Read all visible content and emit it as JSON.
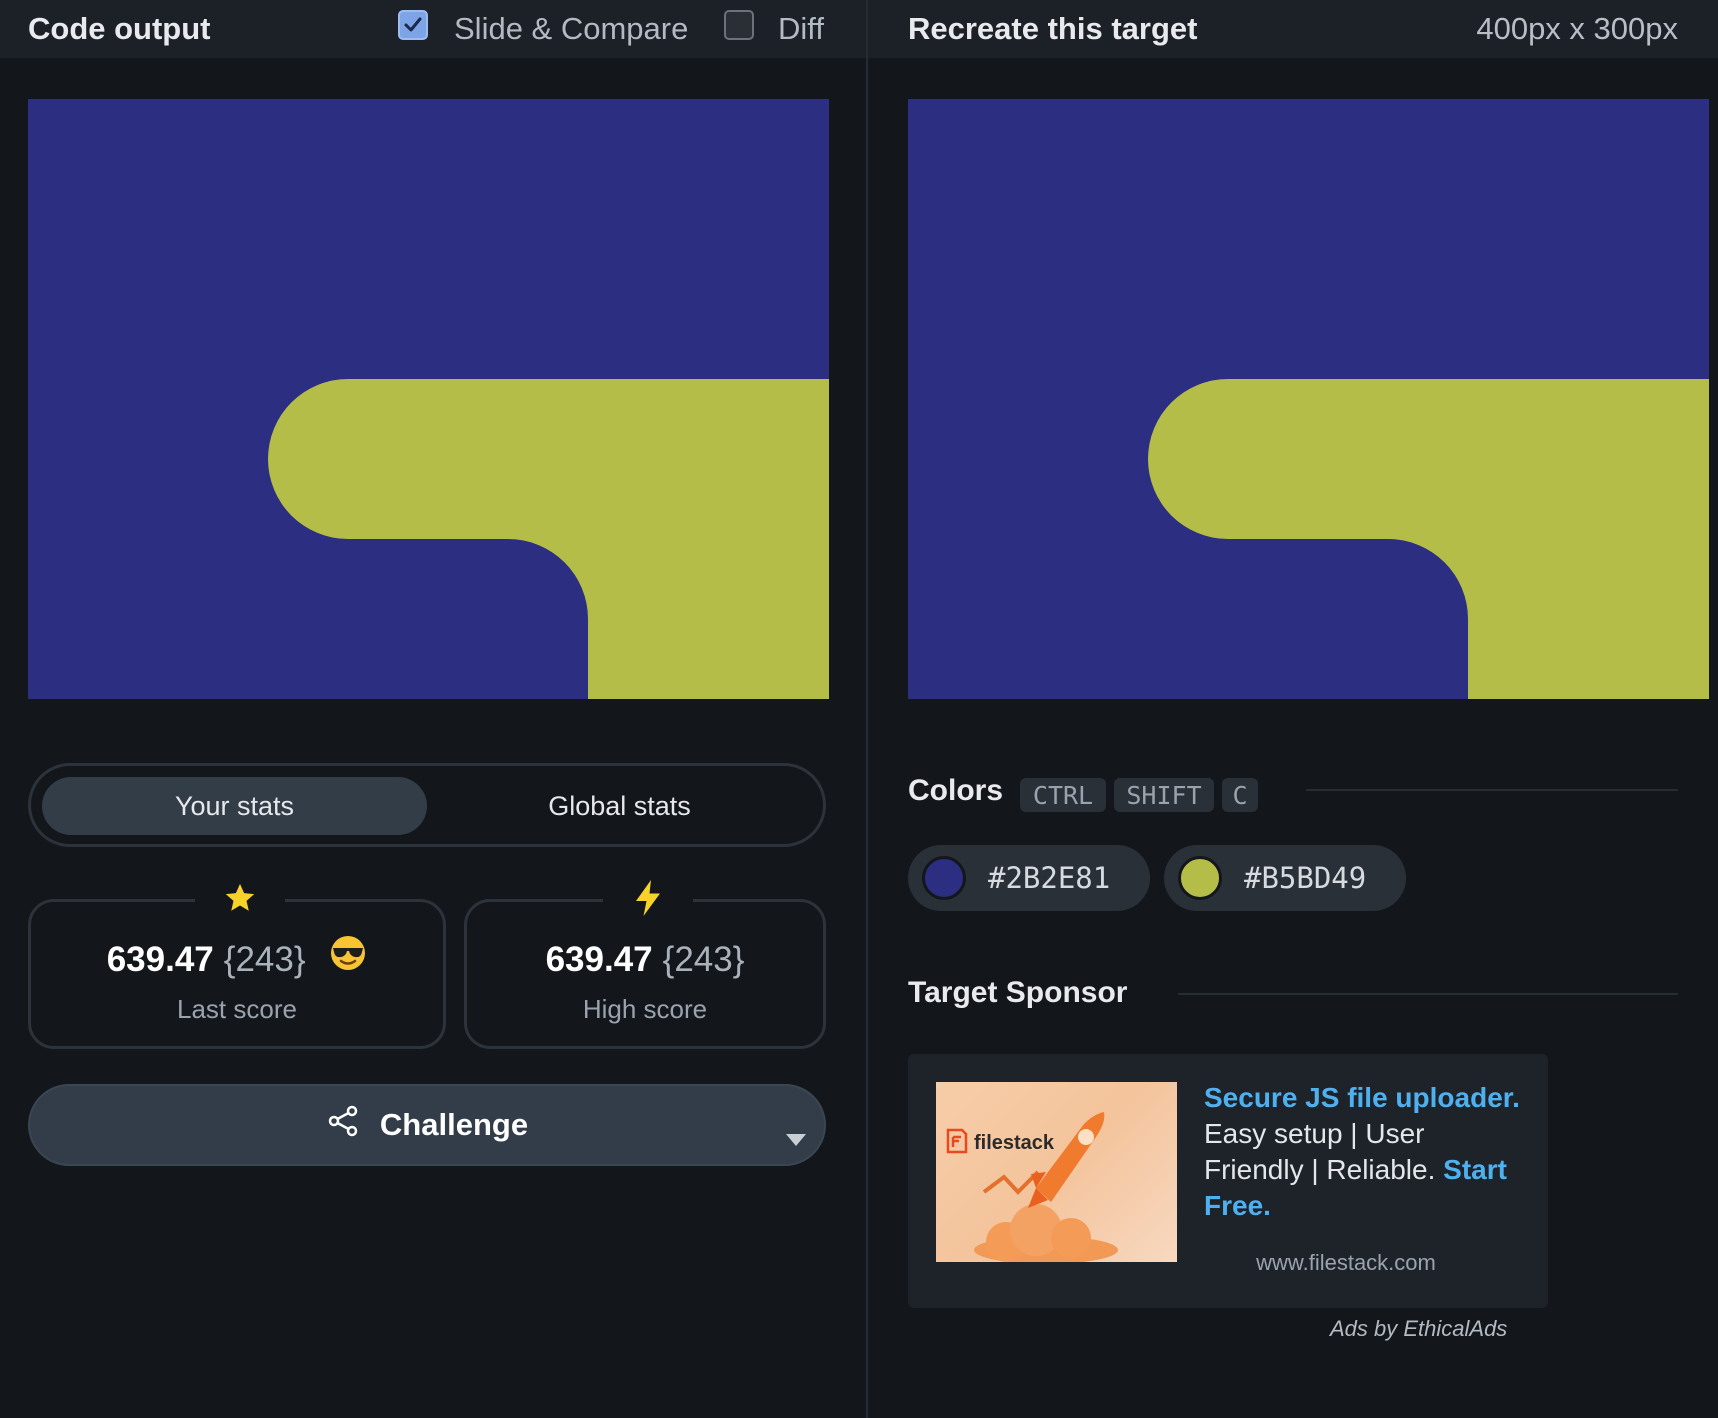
{
  "left_panel": {
    "title": "Code output",
    "slide_compare": {
      "label": "Slide & Compare",
      "checked": true
    },
    "diff": {
      "label": "Diff",
      "checked": false
    }
  },
  "right_panel": {
    "title": "Recreate this target",
    "dimensions": "400px x 300px"
  },
  "stats": {
    "tabs": [
      "Your stats",
      "Global stats"
    ],
    "active_tab": "Your stats",
    "last": {
      "score": "639.47",
      "count": "{243}",
      "label": "Last score",
      "icon": "star-icon",
      "emoji": "sunglasses-emoji"
    },
    "high": {
      "score": "639.47",
      "count": "{243}",
      "label": "High score",
      "icon": "lightning-icon"
    }
  },
  "challenge": {
    "label": "Challenge",
    "icon": "share-icon"
  },
  "colors": {
    "title": "Colors",
    "shortcut": [
      "CTRL",
      "SHIFT",
      "C"
    ],
    "swatches": [
      "#2B2E81",
      "#B5BD49"
    ]
  },
  "sponsor": {
    "title": "Target Sponsor",
    "brand": "filestack",
    "headline": "Secure JS file uploader.",
    "body": " Easy setup | User Friendly | Reliable. ",
    "cta": "Start Free.",
    "url": "www.filestack.com",
    "attribution": "Ads by EthicalAds"
  },
  "palette": {
    "background": "#2B2E81",
    "foreground": "#B5BD49",
    "accent": "#4FB0F0",
    "page_bg": "#13171C"
  }
}
